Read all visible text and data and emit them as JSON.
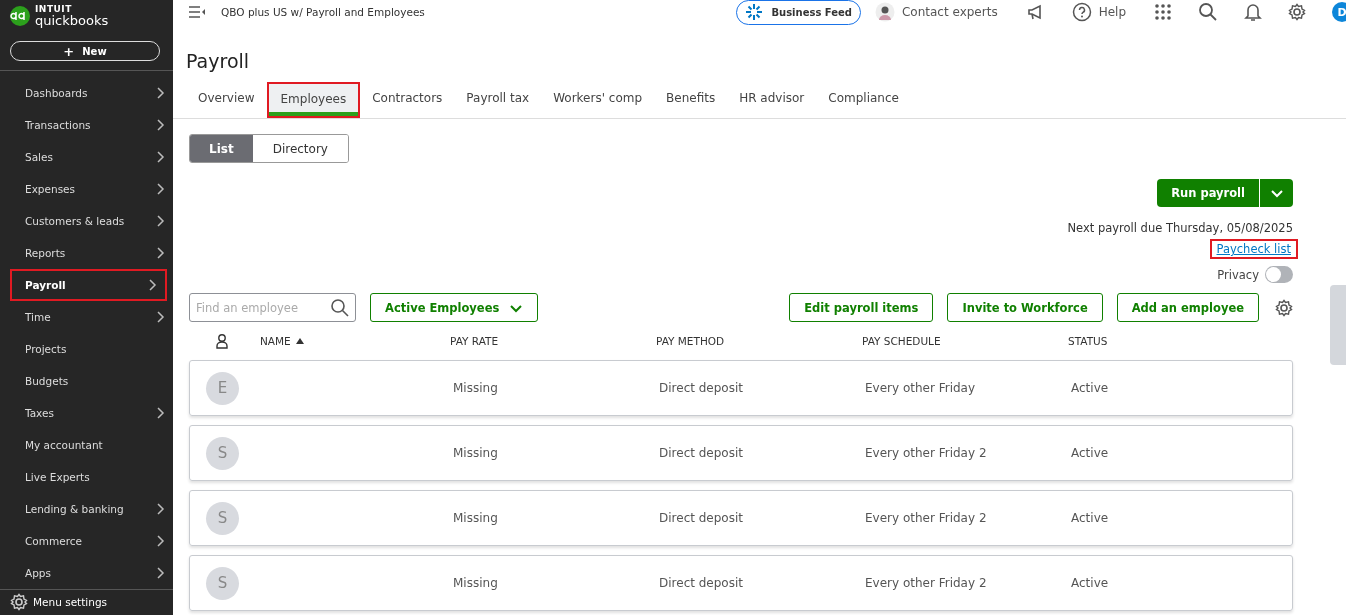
{
  "sidebar": {
    "logo_top": "INTUIT",
    "logo_bottom": "quickbooks",
    "new_button": {
      "icon": "+",
      "label": "New"
    },
    "items": [
      {
        "label": "Dashboards",
        "has_submenu": true,
        "selected": false,
        "highlighted": false
      },
      {
        "label": "Transactions",
        "has_submenu": true,
        "selected": false,
        "highlighted": false
      },
      {
        "label": "Sales",
        "has_submenu": true,
        "selected": false,
        "highlighted": false
      },
      {
        "label": "Expenses",
        "has_submenu": true,
        "selected": false,
        "highlighted": false
      },
      {
        "label": "Customers & leads",
        "has_submenu": true,
        "selected": false,
        "highlighted": false
      },
      {
        "label": "Reports",
        "has_submenu": true,
        "selected": false,
        "highlighted": false
      },
      {
        "label": "Payroll",
        "has_submenu": true,
        "selected": true,
        "highlighted": true
      },
      {
        "label": "Time",
        "has_submenu": true,
        "selected": false,
        "highlighted": false
      },
      {
        "label": "Projects",
        "has_submenu": false,
        "selected": false,
        "highlighted": false
      },
      {
        "label": "Budgets",
        "has_submenu": false,
        "selected": false,
        "highlighted": false
      },
      {
        "label": "Taxes",
        "has_submenu": true,
        "selected": false,
        "highlighted": false
      },
      {
        "label": "My accountant",
        "has_submenu": false,
        "selected": false,
        "highlighted": false
      },
      {
        "label": "Live Experts",
        "has_submenu": false,
        "selected": false,
        "highlighted": false
      },
      {
        "label": "Lending & banking",
        "has_submenu": true,
        "selected": false,
        "highlighted": false
      },
      {
        "label": "Commerce",
        "has_submenu": true,
        "selected": false,
        "highlighted": false
      },
      {
        "label": "Apps",
        "has_submenu": true,
        "selected": false,
        "highlighted": false
      }
    ],
    "menu_settings": "Menu settings"
  },
  "header": {
    "company_name": "QBO plus US w/ Payroll and Employees",
    "business_feed": "Business Feed",
    "contact_experts": "Contact experts",
    "help": "Help",
    "avatar_initial": "D"
  },
  "page_title": "Payroll",
  "tabs": [
    {
      "label": "Overview",
      "selected": false,
      "highlighted": false
    },
    {
      "label": "Employees",
      "selected": true,
      "highlighted": true
    },
    {
      "label": "Contractors",
      "selected": false,
      "highlighted": false
    },
    {
      "label": "Payroll tax",
      "selected": false,
      "highlighted": false
    },
    {
      "label": "Workers' comp",
      "selected": false,
      "highlighted": false
    },
    {
      "label": "Benefits",
      "selected": false,
      "highlighted": false
    },
    {
      "label": "HR advisor",
      "selected": false,
      "highlighted": false
    },
    {
      "label": "Compliance",
      "selected": false,
      "highlighted": false
    }
  ],
  "view_toggle": [
    {
      "label": "List",
      "selected": true
    },
    {
      "label": "Directory",
      "selected": false
    }
  ],
  "run_payroll": "Run payroll",
  "next_payroll": "Next payroll due Thursday, 05/08/2025",
  "paycheck_list": {
    "label": "Paycheck list",
    "highlighted": true
  },
  "privacy": {
    "label": "Privacy",
    "on": false
  },
  "search": {
    "placeholder": "Find an employee"
  },
  "filter": "Active Employees",
  "actions": [
    "Edit payroll items",
    "Invite to Workforce",
    "Add an employee"
  ],
  "table": {
    "columns": [
      "NAME",
      "PAY RATE",
      "PAY METHOD",
      "PAY SCHEDULE",
      "STATUS"
    ],
    "rows": [
      {
        "initial": "E",
        "pay_rate": "Missing",
        "pay_method": "Direct deposit",
        "pay_schedule": "Every other Friday",
        "status": "Active"
      },
      {
        "initial": "S",
        "pay_rate": "Missing",
        "pay_method": "Direct deposit",
        "pay_schedule": "Every other Friday 2",
        "status": "Active"
      },
      {
        "initial": "S",
        "pay_rate": "Missing",
        "pay_method": "Direct deposit",
        "pay_schedule": "Every other Friday 2",
        "status": "Active"
      },
      {
        "initial": "S",
        "pay_rate": "Missing",
        "pay_method": "Direct deposit",
        "pay_schedule": "Every other Friday 2",
        "status": "Active"
      }
    ]
  }
}
